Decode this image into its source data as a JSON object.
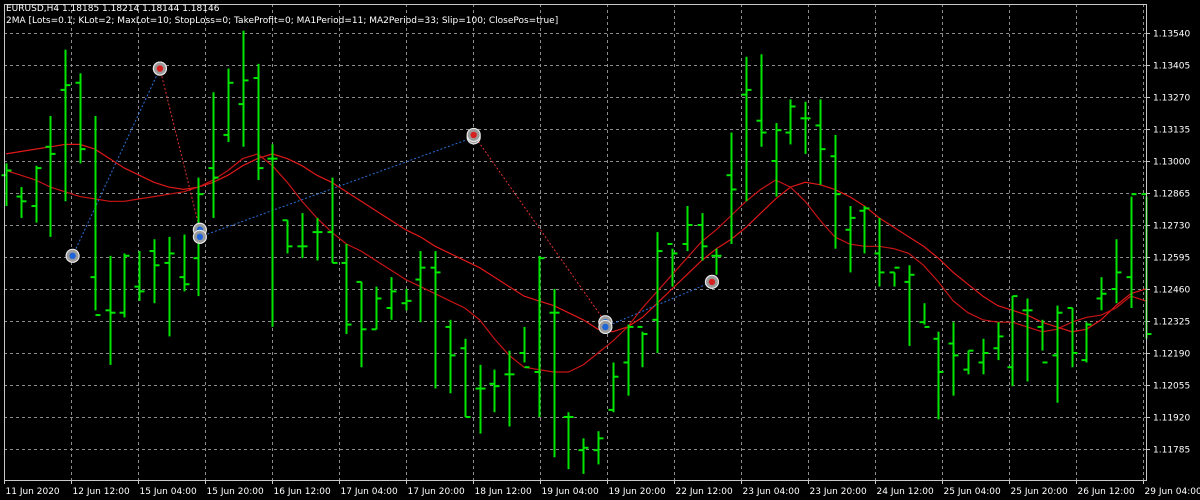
{
  "header": {
    "symbol_line": "EURUSD,H4  1.18185 1.18214 1.18144 1.18146",
    "ea_line": "2MA [Lots=0.1; KLot=2; MaxLot=10; StopLoss=0; TakeProfit=0; MA1Period=11; MA2Period=33; Slip=100; ClosePos=true]"
  },
  "colors": {
    "background": "#000000",
    "grid": "#8c8c8c",
    "axis": "#c8c8c8",
    "text": "#ffffff",
    "bar": "#00e600",
    "ma_fast": "#e01818",
    "ma_slow": "#c81414",
    "trade_line_buy": "#2b6fd6",
    "trade_line_sell": "#e03030"
  },
  "chart_data": {
    "type": "ohlc",
    "symbol": "EURUSD",
    "timeframe": "H4",
    "grid": true,
    "y_ticks": [
      1.1354,
      1.13405,
      1.1327,
      1.13135,
      1.13,
      1.12865,
      1.1273,
      1.12595,
      1.1246,
      1.12325,
      1.1219,
      1.12055,
      1.1192,
      1.11785
    ],
    "y_tick_labels": [
      "1.13540",
      "1.13405",
      "1.13270",
      "1.13135",
      "1.13000",
      "1.12865",
      "1.12730",
      "1.12595",
      "1.12460",
      "1.12325",
      "1.12190",
      "1.12055",
      "1.11920",
      "1.11785"
    ],
    "x_tick_labels": [
      "11 Jun 2020",
      "12 Jun 12:00",
      "15 Jun 04:00",
      "15 Jun 20:00",
      "16 Jun 12:00",
      "17 Jun 04:00",
      "17 Jun 20:00",
      "18 Jun 12:00",
      "19 Jun 04:00",
      "19 Jun 20:00",
      "22 Jun 12:00",
      "23 Jun 04:00",
      "23 Jun 20:00",
      "24 Jun 12:00",
      "25 Jun 04:00",
      "25 Jun 20:00",
      "26 Jun 12:00",
      "29 Jun 04:00"
    ],
    "bars": [
      {
        "o": 1.1294,
        "h": 1.1299,
        "l": 1.1281,
        "c": 1.1296
      },
      {
        "o": 1.1285,
        "h": 1.1289,
        "l": 1.1276,
        "c": 1.1283
      },
      {
        "o": 1.1281,
        "h": 1.1298,
        "l": 1.1274,
        "c": 1.1297
      },
      {
        "o": 1.1306,
        "h": 1.1319,
        "l": 1.1268,
        "c": 1.1303
      },
      {
        "o": 1.133,
        "h": 1.1347,
        "l": 1.1283,
        "c": 1.1332
      },
      {
        "o": 1.1333,
        "h": 1.1337,
        "l": 1.1299,
        "c": 1.1305
      },
      {
        "o": 1.1251,
        "h": 1.1319,
        "l": 1.1237,
        "c": 1.1235
      },
      {
        "o": 1.1237,
        "h": 1.126,
        "l": 1.1214,
        "c": 1.1236
      },
      {
        "o": 1.1236,
        "h": 1.1261,
        "l": 1.1234,
        "c": 1.126
      },
      {
        "o": 1.1247,
        "h": 1.1262,
        "l": 1.1241,
        "c": 1.1245
      },
      {
        "o": 1.1262,
        "h": 1.1267,
        "l": 1.124,
        "c": 1.1256
      },
      {
        "o": 1.1257,
        "h": 1.1268,
        "l": 1.1226,
        "c": 1.1261
      },
      {
        "o": 1.1251,
        "h": 1.1269,
        "l": 1.1245,
        "c": 1.1248
      },
      {
        "o": 1.1259,
        "h": 1.1293,
        "l": 1.1243,
        "c": 1.1286
      },
      {
        "o": 1.1297,
        "h": 1.1329,
        "l": 1.1276,
        "c": 1.1293
      },
      {
        "o": 1.1311,
        "h": 1.1339,
        "l": 1.1308,
        "c": 1.1333
      },
      {
        "o": 1.1324,
        "h": 1.1355,
        "l": 1.1306,
        "c": 1.1334
      },
      {
        "o": 1.1335,
        "h": 1.1341,
        "l": 1.1292,
        "c": 1.1297
      },
      {
        "o": 1.1301,
        "h": 1.1307,
        "l": 1.123,
        "c": 1.1301
      },
      {
        "o": 1.1275,
        "h": 1.1275,
        "l": 1.1261,
        "c": 1.1264
      },
      {
        "o": 1.1264,
        "h": 1.1278,
        "l": 1.1259,
        "c": 1.1264
      },
      {
        "o": 1.127,
        "h": 1.1276,
        "l": 1.1258,
        "c": 1.127
      },
      {
        "o": 1.127,
        "h": 1.1293,
        "l": 1.1257,
        "c": 1.1257
      },
      {
        "o": 1.1257,
        "h": 1.1265,
        "l": 1.1227,
        "c": 1.1231
      },
      {
        "o": 1.1249,
        "h": 1.1249,
        "l": 1.1213,
        "c": 1.1229
      },
      {
        "o": 1.1229,
        "h": 1.1247,
        "l": 1.1229,
        "c": 1.1242
      },
      {
        "o": 1.1238,
        "h": 1.1251,
        "l": 1.1233,
        "c": 1.1245
      },
      {
        "o": 1.124,
        "h": 1.1246,
        "l": 1.1237,
        "c": 1.1241
      },
      {
        "o": 1.125,
        "h": 1.1262,
        "l": 1.1232,
        "c": 1.1255
      },
      {
        "o": 1.1255,
        "h": 1.1262,
        "l": 1.1204,
        "c": 1.1253
      },
      {
        "o": 1.123,
        "h": 1.1233,
        "l": 1.1202,
        "c": 1.1218
      },
      {
        "o": 1.1221,
        "h": 1.1225,
        "l": 1.1192,
        "c": 1.1192
      },
      {
        "o": 1.1204,
        "h": 1.1214,
        "l": 1.1185,
        "c": 1.1204
      },
      {
        "o": 1.1206,
        "h": 1.1212,
        "l": 1.1194,
        "c": 1.1205
      },
      {
        "o": 1.121,
        "h": 1.122,
        "l": 1.1188,
        "c": 1.121
      },
      {
        "o": 1.1219,
        "h": 1.123,
        "l": 1.1215,
        "c": 1.1213
      },
      {
        "o": 1.1211,
        "h": 1.126,
        "l": 1.1192,
        "c": 1.1259
      },
      {
        "o": 1.1236,
        "h": 1.1246,
        "l": 1.1175,
        "c": 1.1236
      },
      {
        "o": 1.1192,
        "h": 1.1194,
        "l": 1.117,
        "c": 1.1192
      },
      {
        "o": 1.1178,
        "h": 1.1183,
        "l": 1.1168,
        "c": 1.1179
      },
      {
        "o": 1.1178,
        "h": 1.1186,
        "l": 1.1172,
        "c": 1.1183
      },
      {
        "o": 1.1195,
        "h": 1.1215,
        "l": 1.1194,
        "c": 1.1209
      },
      {
        "o": 1.1215,
        "h": 1.1231,
        "l": 1.1201,
        "c": 1.123
      },
      {
        "o": 1.123,
        "h": 1.1228,
        "l": 1.1213,
        "c": 1.1227
      },
      {
        "o": 1.1233,
        "h": 1.127,
        "l": 1.1219,
        "c": 1.1262
      },
      {
        "o": 1.1265,
        "h": 1.1263,
        "l": 1.1247,
        "c": 1.1261
      },
      {
        "o": 1.1265,
        "h": 1.1281,
        "l": 1.1262,
        "c": 1.1273
      },
      {
        "o": 1.1273,
        "h": 1.1278,
        "l": 1.1258,
        "c": 1.1264
      },
      {
        "o": 1.126,
        "h": 1.1263,
        "l": 1.1252,
        "c": 1.126
      },
      {
        "o": 1.1294,
        "h": 1.1312,
        "l": 1.1265,
        "c": 1.1288
      },
      {
        "o": 1.1328,
        "h": 1.1344,
        "l": 1.1283,
        "c": 1.133
      },
      {
        "o": 1.1317,
        "h": 1.1345,
        "l": 1.1306,
        "c": 1.1312
      },
      {
        "o": 1.13,
        "h": 1.1316,
        "l": 1.1285,
        "c": 1.1313
      },
      {
        "o": 1.1312,
        "h": 1.1326,
        "l": 1.1307,
        "c": 1.1323
      },
      {
        "o": 1.1318,
        "h": 1.1325,
        "l": 1.1303,
        "c": 1.1318
      },
      {
        "o": 1.1315,
        "h": 1.1326,
        "l": 1.129,
        "c": 1.1305
      },
      {
        "o": 1.1302,
        "h": 1.1311,
        "l": 1.1263,
        "c": 1.1286
      },
      {
        "o": 1.1271,
        "h": 1.1281,
        "l": 1.1253,
        "c": 1.1276
      },
      {
        "o": 1.1279,
        "h": 1.1281,
        "l": 1.1261,
        "c": 1.128
      },
      {
        "o": 1.1261,
        "h": 1.1276,
        "l": 1.1247,
        "c": 1.1253
      },
      {
        "o": 1.1253,
        "h": 1.1253,
        "l": 1.1247,
        "c": 1.1255
      },
      {
        "o": 1.1249,
        "h": 1.1256,
        "l": 1.1222,
        "c": 1.1252
      },
      {
        "o": 1.1232,
        "h": 1.124,
        "l": 1.1231,
        "c": 1.123
      },
      {
        "o": 1.1225,
        "h": 1.1228,
        "l": 1.1191,
        "c": 1.1211
      },
      {
        "o": 1.1223,
        "h": 1.1232,
        "l": 1.1201,
        "c": 1.1218
      },
      {
        "o": 1.1212,
        "h": 1.122,
        "l": 1.121,
        "c": 1.122
      },
      {
        "o": 1.1215,
        "h": 1.1225,
        "l": 1.121,
        "c": 1.1219
      },
      {
        "o": 1.1221,
        "h": 1.1232,
        "l": 1.1216,
        "c": 1.1226
      },
      {
        "o": 1.1213,
        "h": 1.1243,
        "l": 1.1205,
        "c": 1.1243
      },
      {
        "o": 1.1237,
        "h": 1.1242,
        "l": 1.1207,
        "c": 1.1237
      },
      {
        "o": 1.123,
        "h": 1.1233,
        "l": 1.122,
        "c": 1.1215
      },
      {
        "o": 1.1218,
        "h": 1.1239,
        "l": 1.1198,
        "c": 1.1236
      },
      {
        "o": 1.1238,
        "h": 1.1238,
        "l": 1.1213,
        "c": 1.1219
      },
      {
        "o": 1.1216,
        "h": 1.1232,
        "l": 1.1215,
        "c": 1.1231
      },
      {
        "o": 1.1242,
        "h": 1.1251,
        "l": 1.1237,
        "c": 1.1244
      },
      {
        "o": 1.1246,
        "h": 1.1267,
        "l": 1.124,
        "c": 1.1253
      },
      {
        "o": 1.1251,
        "h": 1.1285,
        "l": 1.1238,
        "c": 1.1286
      },
      {
        "o": 1.1286,
        "h": 1.1285,
        "l": 1.1225,
        "c": 1.1227
      }
    ],
    "moving_averages": [
      {
        "name": "MA1Period=11",
        "values": [
          1.1303,
          1.1304,
          1.1305,
          1.1306,
          1.1307,
          1.1307,
          1.1305,
          1.1301,
          1.1297,
          1.1294,
          1.1291,
          1.1289,
          1.1288,
          1.1289,
          1.1291,
          1.1294,
          1.1298,
          1.1301,
          1.1303,
          1.1301,
          1.1298,
          1.1294,
          1.1291,
          1.1287,
          1.1283,
          1.1279,
          1.1275,
          1.1271,
          1.1268,
          1.1264,
          1.1261,
          1.1258,
          1.1255,
          1.1251,
          1.1247,
          1.1243,
          1.1241,
          1.1239,
          1.1236,
          1.1233,
          1.1229,
          1.1228,
          1.123,
          1.1234,
          1.124,
          1.1246,
          1.1252,
          1.1258,
          1.1263,
          1.1267,
          1.1272,
          1.1278,
          1.1284,
          1.1289,
          1.1291,
          1.129,
          1.1288,
          1.1285,
          1.1281,
          1.1276,
          1.1272,
          1.1268,
          1.1264,
          1.1259,
          1.1253,
          1.1248,
          1.1243,
          1.1239,
          1.1237,
          1.1235,
          1.1232,
          1.123,
          1.1228,
          1.1229,
          1.1233,
          1.1239,
          1.1244,
          1.1246
        ]
      },
      {
        "name": "MA2Period=33",
        "values": [
          1.1296,
          1.1294,
          1.1292,
          1.1289,
          1.1287,
          1.1285,
          1.1284,
          1.1283,
          1.1283,
          1.1284,
          1.1285,
          1.1286,
          1.1287,
          1.1289,
          1.1292,
          1.1296,
          1.1301,
          1.1303,
          1.1298,
          1.1291,
          1.1283,
          1.1276,
          1.127,
          1.1265,
          1.1262,
          1.1258,
          1.1254,
          1.125,
          1.1247,
          1.1244,
          1.1241,
          1.1238,
          1.1233,
          1.1225,
          1.1218,
          1.1213,
          1.1212,
          1.1211,
          1.1211,
          1.1214,
          1.1219,
          1.1224,
          1.123,
          1.1238,
          1.1245,
          1.1252,
          1.1259,
          1.1266,
          1.1271,
          1.1277,
          1.1283,
          1.1288,
          1.1292,
          1.1289,
          1.1283,
          1.1275,
          1.1268,
          1.1265,
          1.1264,
          1.1264,
          1.1263,
          1.1261,
          1.1256,
          1.1249,
          1.1241,
          1.1236,
          1.1233,
          1.1232,
          1.1232,
          1.123,
          1.1228,
          1.1229,
          1.1232,
          1.1234,
          1.1235,
          1.1238,
          1.1243,
          1.1241
        ]
      }
    ],
    "trades": [
      {
        "type": "buy",
        "open_bar": 4.5,
        "open_price": 1.126,
        "close_bar": 10.4,
        "close_price": 1.1339
      },
      {
        "type": "sell",
        "open_bar": 10.4,
        "open_price": 1.1339,
        "close_bar": 13.1,
        "close_price": 1.1271
      },
      {
        "type": "buy",
        "open_bar": 13.1,
        "open_price": 1.1268,
        "close_bar": 31.6,
        "close_price": 1.131
      },
      {
        "type": "sell",
        "open_bar": 31.6,
        "open_price": 1.1311,
        "close_bar": 40.5,
        "close_price": 1.1232
      },
      {
        "type": "buy",
        "open_bar": 40.5,
        "open_price": 1.123,
        "close_bar": 47.7,
        "close_price": 1.1249
      }
    ]
  }
}
